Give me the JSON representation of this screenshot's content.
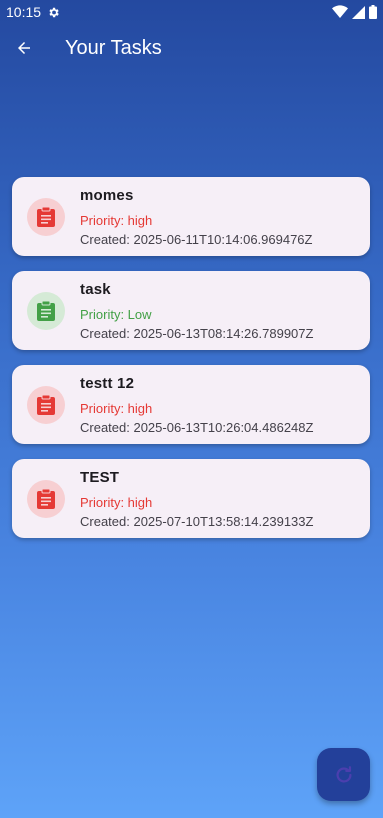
{
  "status_bar": {
    "time": "10:15"
  },
  "app_bar": {
    "title": "Your Tasks"
  },
  "tasks": [
    {
      "title": "momes",
      "priority_text": "Priority: high",
      "priority": "high",
      "created_text": "Created: 2025-06-11T10:14:06.969476Z"
    },
    {
      "title": "task",
      "priority_text": "Priority: Low",
      "priority": "low",
      "created_text": "Created: 2025-06-13T08:14:26.789907Z"
    },
    {
      "title": "testt 12",
      "priority_text": "Priority: high",
      "priority": "high",
      "created_text": "Created: 2025-06-13T10:26:04.486248Z"
    },
    {
      "title": "TEST",
      "priority_text": "Priority: high",
      "priority": "high",
      "created_text": "Created: 2025-07-10T13:58:14.239133Z"
    }
  ],
  "colors": {
    "high_accent": "#e53935",
    "low_accent": "#43a047",
    "card_bg": "#f6eff7",
    "fab_bg": "#23409a"
  },
  "icons": {
    "task_icon": "clipboard-icon",
    "fab_icon": "refresh-icon",
    "back_icon": "arrow-back-icon"
  }
}
